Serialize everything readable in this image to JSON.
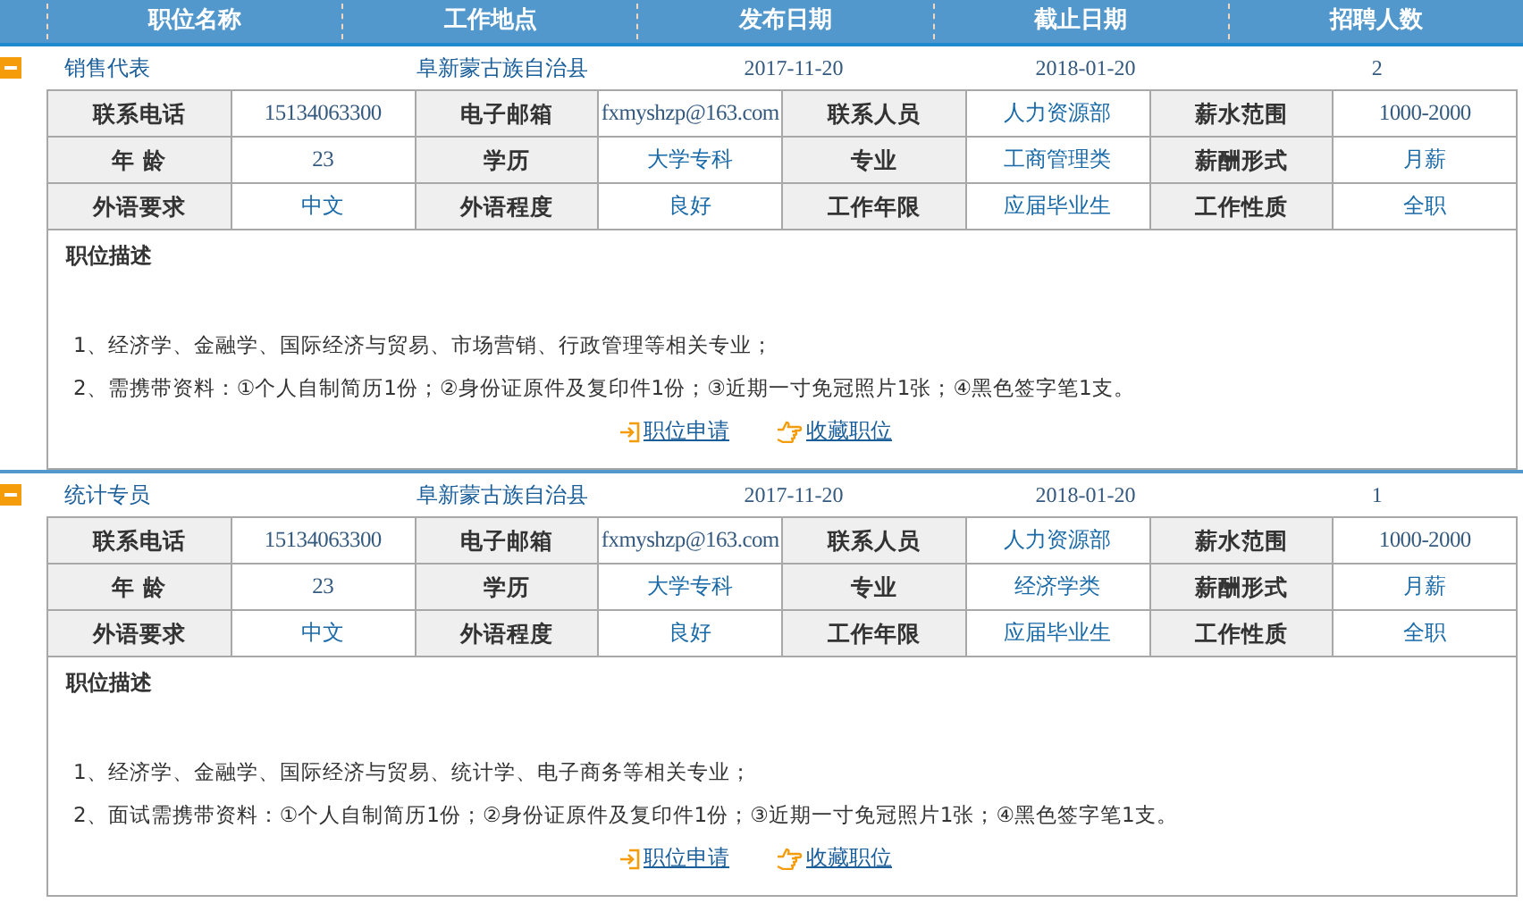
{
  "columns": [
    "职位名称",
    "工作地点",
    "发布日期",
    "截止日期",
    "招聘人数"
  ],
  "jobs": [
    {
      "expanded": true,
      "title": "销售代表",
      "location": "阜新蒙古族自治县",
      "posted": "2017-11-20",
      "deadline": "2018-01-20",
      "openings": "2",
      "details": [
        {
          "label": "联系电话",
          "value": "15134063300"
        },
        {
          "label": "电子邮箱",
          "value": "fxmyshzp@163.com"
        },
        {
          "label": "联系人员",
          "value": "人力资源部"
        },
        {
          "label": "薪水范围",
          "value": "1000-2000"
        },
        {
          "label": "年 龄",
          "value": "23"
        },
        {
          "label": "学历",
          "value": "大学专科"
        },
        {
          "label": "专业",
          "value": "工商管理类"
        },
        {
          "label": "薪酬形式",
          "value": "月薪"
        },
        {
          "label": "外语要求",
          "value": "中文"
        },
        {
          "label": "外语程度",
          "value": "良好"
        },
        {
          "label": "工作年限",
          "value": "应届毕业生"
        },
        {
          "label": "工作性质",
          "value": "全职"
        }
      ],
      "description_title": "职位描述",
      "description": [
        "1、经济学、金融学、国际经济与贸易、市场营销、行政管理等相关专业；",
        "2、需携带资料：①个人自制简历1份；②身份证原件及复印件1份；③近期一寸免冠照片1张；④黑色签字笔1支。"
      ],
      "actions": [
        {
          "kind": "apply",
          "label": "职位申请"
        },
        {
          "kind": "favorite",
          "label": "收藏职位"
        }
      ]
    },
    {
      "expanded": true,
      "title": "统计专员",
      "location": "阜新蒙古族自治县",
      "posted": "2017-11-20",
      "deadline": "2018-01-20",
      "openings": "1",
      "details": [
        {
          "label": "联系电话",
          "value": "15134063300"
        },
        {
          "label": "电子邮箱",
          "value": "fxmyshzp@163.com"
        },
        {
          "label": "联系人员",
          "value": "人力资源部"
        },
        {
          "label": "薪水范围",
          "value": "1000-2000"
        },
        {
          "label": "年 龄",
          "value": "23"
        },
        {
          "label": "学历",
          "value": "大学专科"
        },
        {
          "label": "专业",
          "value": "经济学类"
        },
        {
          "label": "薪酬形式",
          "value": "月薪"
        },
        {
          "label": "外语要求",
          "value": "中文"
        },
        {
          "label": "外语程度",
          "value": "良好"
        },
        {
          "label": "工作年限",
          "value": "应届毕业生"
        },
        {
          "label": "工作性质",
          "value": "全职"
        }
      ],
      "description_title": "职位描述",
      "description": [
        "1、经济学、金融学、国际经济与贸易、统计学、电子商务等相关专业；",
        "2、面试需携带资料：①个人自制简历1份；②身份证原件及复印件1份；③近期一寸免冠照片1张；④黑色签字笔1支。"
      ],
      "actions": [
        {
          "kind": "apply",
          "label": "职位申请"
        },
        {
          "kind": "favorite",
          "label": "收藏职位"
        }
      ]
    }
  ]
}
